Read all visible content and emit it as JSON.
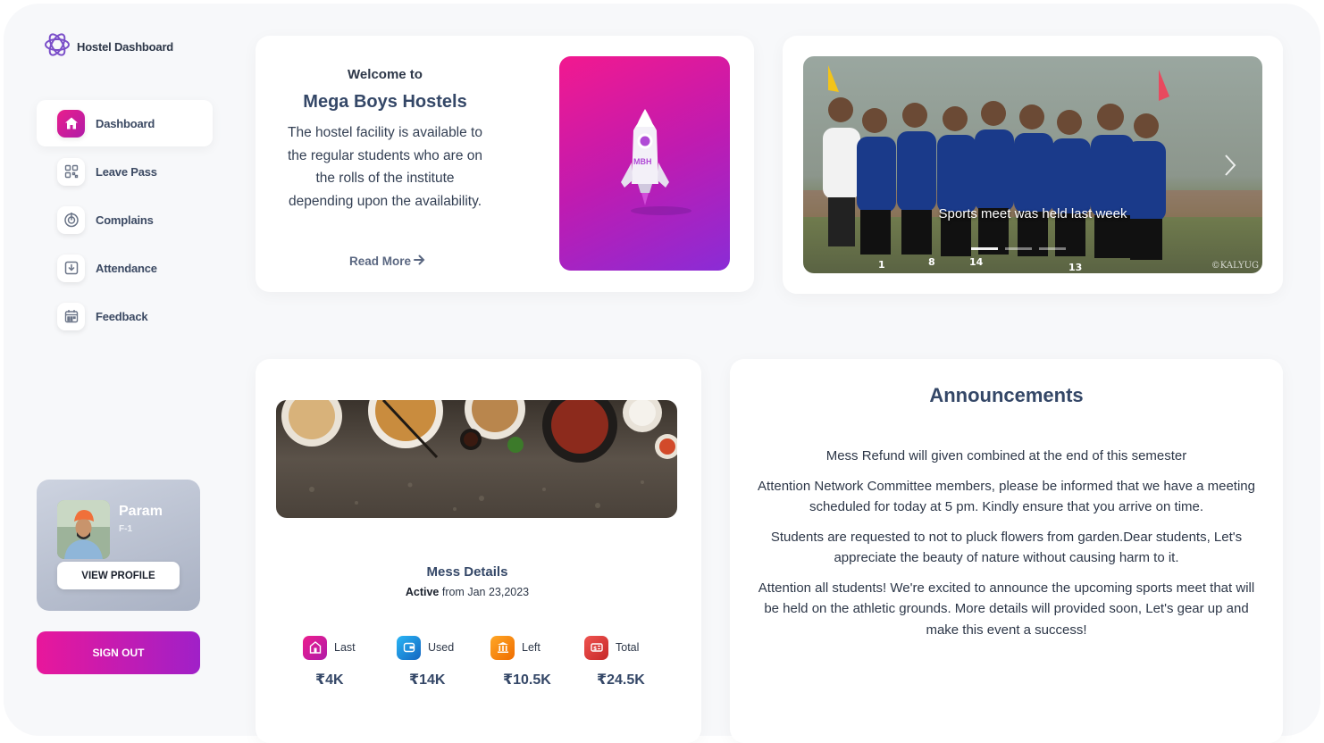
{
  "brand": {
    "name": "Hostel Dashboard",
    "icon": "brand-logo-icon"
  },
  "sidebar": {
    "items": [
      {
        "label": "Dashboard",
        "icon": "home-icon",
        "active": true
      },
      {
        "label": "Leave Pass",
        "icon": "qr-code-icon",
        "active": false
      },
      {
        "label": "Complains",
        "icon": "target-icon",
        "active": false
      },
      {
        "label": "Attendance",
        "icon": "download-tray-icon",
        "active": false
      },
      {
        "label": "Feedback",
        "icon": "calendar-icon",
        "active": false
      }
    ]
  },
  "profile": {
    "name": "Param",
    "room": "F-1",
    "button": "VIEW PROFILE"
  },
  "signout": {
    "label": "SIGN OUT"
  },
  "welcome": {
    "small": "Welcome to",
    "title": "Mega Boys Hostels",
    "description": "The hostel facility is available to the regular students who are on the rolls of the institute depending upon the availability.",
    "read_more": "Read More",
    "rocket_text": "MBH"
  },
  "slider": {
    "caption": "Sports meet was held last week",
    "watermark": "©KALYUG",
    "jersey_numbers": [
      "1",
      "8",
      "14",
      "13"
    ]
  },
  "mess": {
    "title": "Mess Details",
    "status_bold": "Active",
    "status_rest": " from Jan 23,2023",
    "stats": [
      {
        "label": "Last",
        "value": "₹4K",
        "icon": "hostel-icon",
        "color": "#d0148f"
      },
      {
        "label": "Used",
        "value": "₹14K",
        "icon": "wallet-icon",
        "color": "#1e88e5"
      },
      {
        "label": "Left",
        "value": "₹10.5K",
        "icon": "bank-icon",
        "color": "#f57c00"
      },
      {
        "label": "Total",
        "value": "₹24.5K",
        "icon": "cash-icon",
        "color": "#e53935"
      }
    ]
  },
  "announcements": {
    "title": "Announcements",
    "items": [
      "Mess Refund will given combined at the end of this semester",
      "Attention Network Committee members, please be informed that we have a meeting scheduled for today at 5 pm. Kindly ensure that you arrive on time.",
      "Students are requested to not to pluck flowers from garden.Dear students, Let's appreciate the beauty of nature without causing harm to it.",
      "Attention all students! We're excited to announce the upcoming sports meet that will be held on the athletic grounds. More details will provided soon, Let's gear up and make this event a success!"
    ]
  },
  "colors": {
    "accent_pink": "#e8179b",
    "accent_purple": "#a020c8",
    "heading": "#344767",
    "background": "#f7f8fa"
  }
}
